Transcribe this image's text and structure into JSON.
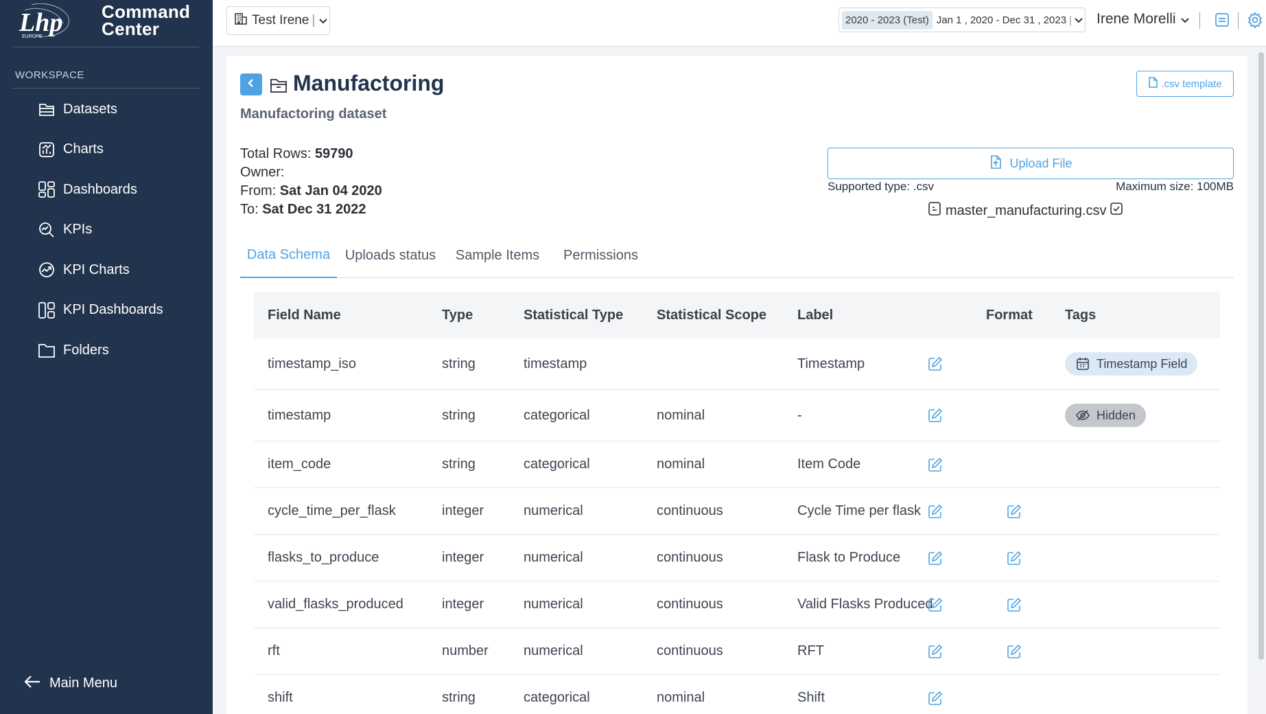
{
  "brand": {
    "name": "Command Center",
    "logo_text": "Lhp",
    "logo_subtext": "EUROPE"
  },
  "sidebar": {
    "section": "WORKSPACE",
    "items": [
      {
        "label": "Datasets",
        "icon": "datasets-icon"
      },
      {
        "label": "Charts",
        "icon": "charts-icon"
      },
      {
        "label": "Dashboards",
        "icon": "dashboards-icon"
      },
      {
        "label": "KPIs",
        "icon": "kpis-icon"
      },
      {
        "label": "KPI Charts",
        "icon": "kpi-charts-icon"
      },
      {
        "label": "KPI Dashboards",
        "icon": "kpi-dashboards-icon"
      },
      {
        "label": "Folders",
        "icon": "folder-icon"
      }
    ],
    "main_menu": "Main Menu"
  },
  "topbar": {
    "org": "Test Irene",
    "date_preset": "2020 - 2023 (Test)",
    "date_range": "Jan 1 , 2020 - Dec 31 , 2023",
    "user": "Irene Morelli"
  },
  "dataset": {
    "title": "Manufactoring",
    "subtitle": "Manufactoring dataset",
    "csv_template": ".csv template",
    "total_rows_label": "Total Rows:",
    "total_rows": "59790",
    "owner_label": "Owner:",
    "owner": "",
    "from_label": "From:",
    "from": "Sat Jan 04 2020",
    "to_label": "To:",
    "to": "Sat Dec 31 2022",
    "upload_label": "Upload File",
    "supported": "Supported type: .csv",
    "max_size": "Maximum size: 100MB",
    "file_name": "master_manufacturing.csv"
  },
  "tabs": [
    "Data Schema",
    "Uploads status",
    "Sample Items",
    "Permissions"
  ],
  "active_tab": "Data Schema",
  "accent_color": "#4fa3e3",
  "sidebar_color": "#22344d",
  "schema": {
    "headers": [
      "Field Name",
      "Type",
      "Statistical Type",
      "Statistical Scope",
      "Label",
      "Format",
      "Tags"
    ],
    "rows": [
      {
        "field": "timestamp_iso",
        "type": "string",
        "stat_type": "timestamp",
        "scope": "",
        "label": "Timestamp",
        "format_editable": false,
        "tag": "Timestamp Field",
        "tag_kind": "timestamp"
      },
      {
        "field": "timestamp",
        "type": "string",
        "stat_type": "categorical",
        "scope": "nominal",
        "label": "-",
        "format_editable": false,
        "tag": "Hidden",
        "tag_kind": "hidden"
      },
      {
        "field": "item_code",
        "type": "string",
        "stat_type": "categorical",
        "scope": "nominal",
        "label": "Item Code",
        "format_editable": false,
        "tag": "",
        "tag_kind": ""
      },
      {
        "field": "cycle_time_per_flask",
        "type": "integer",
        "stat_type": "numerical",
        "scope": "continuous",
        "label": "Cycle Time per flask",
        "format_editable": true,
        "tag": "",
        "tag_kind": ""
      },
      {
        "field": "flasks_to_produce",
        "type": "integer",
        "stat_type": "numerical",
        "scope": "continuous",
        "label": "Flask to Produce",
        "format_editable": true,
        "tag": "",
        "tag_kind": ""
      },
      {
        "field": "valid_flasks_produced",
        "type": "integer",
        "stat_type": "numerical",
        "scope": "continuous",
        "label": "Valid Flasks Produced",
        "format_editable": true,
        "tag": "",
        "tag_kind": ""
      },
      {
        "field": "rft",
        "type": "number",
        "stat_type": "numerical",
        "scope": "continuous",
        "label": "RFT",
        "format_editable": true,
        "tag": "",
        "tag_kind": ""
      },
      {
        "field": "shift",
        "type": "string",
        "stat_type": "categorical",
        "scope": "nominal",
        "label": "Shift",
        "format_editable": false,
        "tag": "",
        "tag_kind": ""
      }
    ]
  }
}
